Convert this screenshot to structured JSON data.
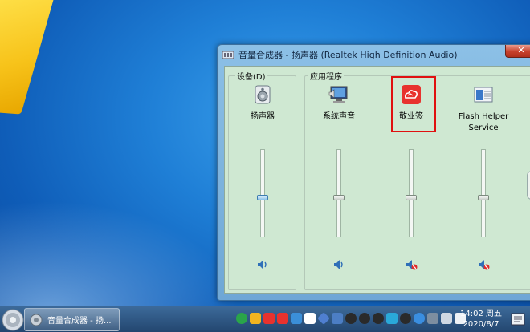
{
  "window": {
    "title": "音量合成器 - 扬声器 (Realtek High Definition Audio)",
    "close_label": "✕"
  },
  "devices": {
    "label": "设备(D)",
    "items": [
      {
        "name": "扬声器",
        "icon": "speaker-device-icon",
        "volume": 0.48,
        "muted": false
      }
    ]
  },
  "apps": {
    "label": "应用程序",
    "items": [
      {
        "name": "系统声音",
        "icon": "system-sounds-icon",
        "volume": 0.48,
        "muted": false
      },
      {
        "name": "敬业签",
        "icon": "jingyeqian-app-icon",
        "volume": 0.48,
        "muted": true,
        "highlighted": true
      },
      {
        "name": "Flash Helper Service",
        "icon": "flash-helper-icon",
        "volume": 0.48,
        "muted": true
      }
    ]
  },
  "taskbar": {
    "active_task": "音量合成器 - 扬...",
    "clock_time": "14:02 周五",
    "clock_date": "2020/8/7"
  },
  "colors": {
    "highlight": "#e01010",
    "client_bg": "#cfe8d2",
    "taskbar": "#2b507a"
  }
}
